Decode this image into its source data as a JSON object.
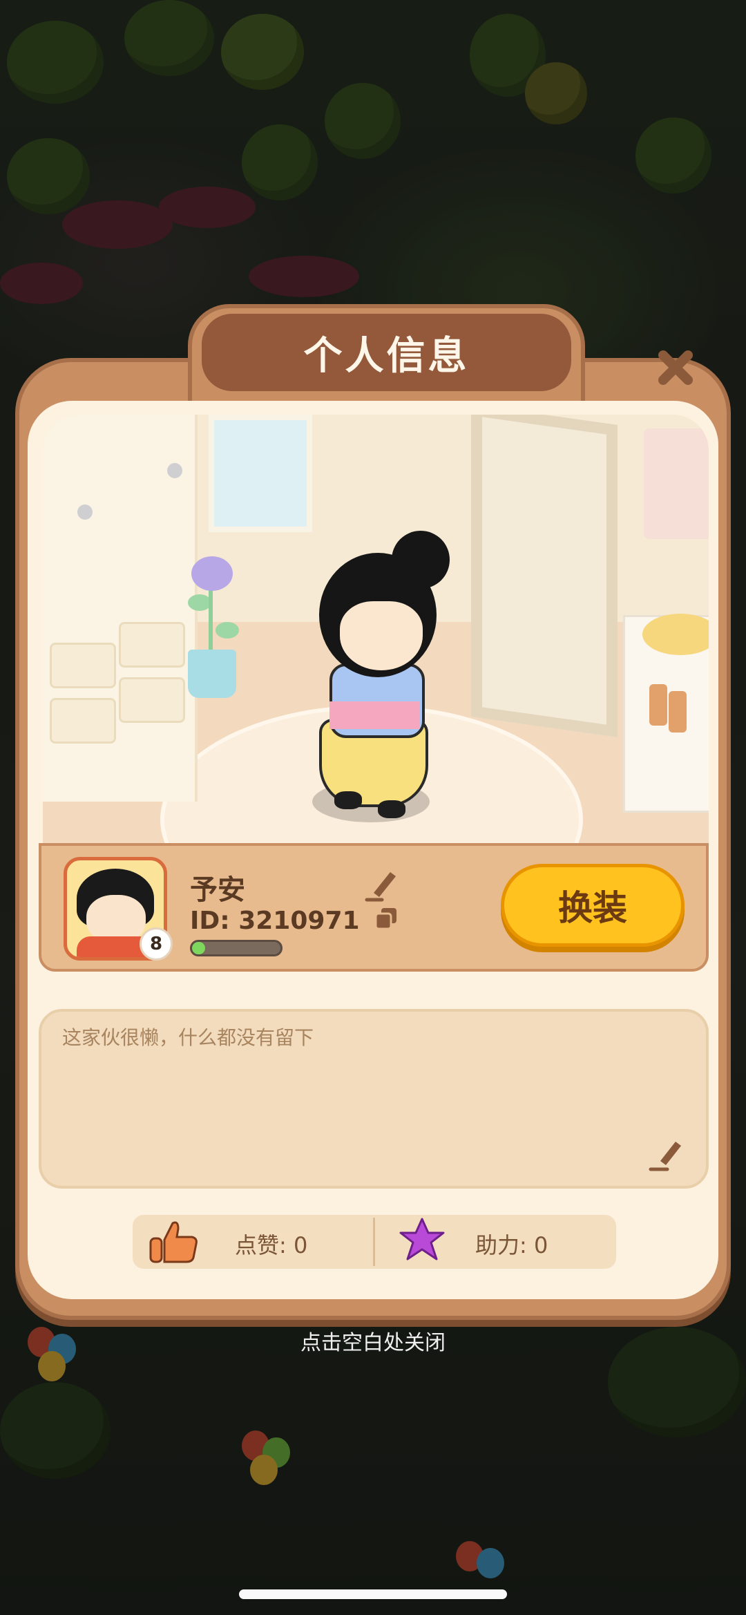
{
  "dialog": {
    "title": "个人信息",
    "close_icon": "close-icon"
  },
  "profile": {
    "name": "予安",
    "id_label": "ID: 3210971",
    "level": "8",
    "xp_progress": 0.15,
    "dress_button": "换装"
  },
  "bio": {
    "text": "这家伙很懒，什么都没有留下"
  },
  "stats": {
    "likes_label": "点赞: 0",
    "help_label": "助力: 0"
  },
  "footer": {
    "hint": "点击空白处关闭"
  },
  "colors": {
    "frame": "#c98e62",
    "title_bg": "#93593a",
    "panel": "#fdf1df",
    "button": "#ffc21f",
    "xp_fill": "#7ed85d",
    "like_icon": "#f08a4b",
    "help_icon": "#b94ad8"
  }
}
